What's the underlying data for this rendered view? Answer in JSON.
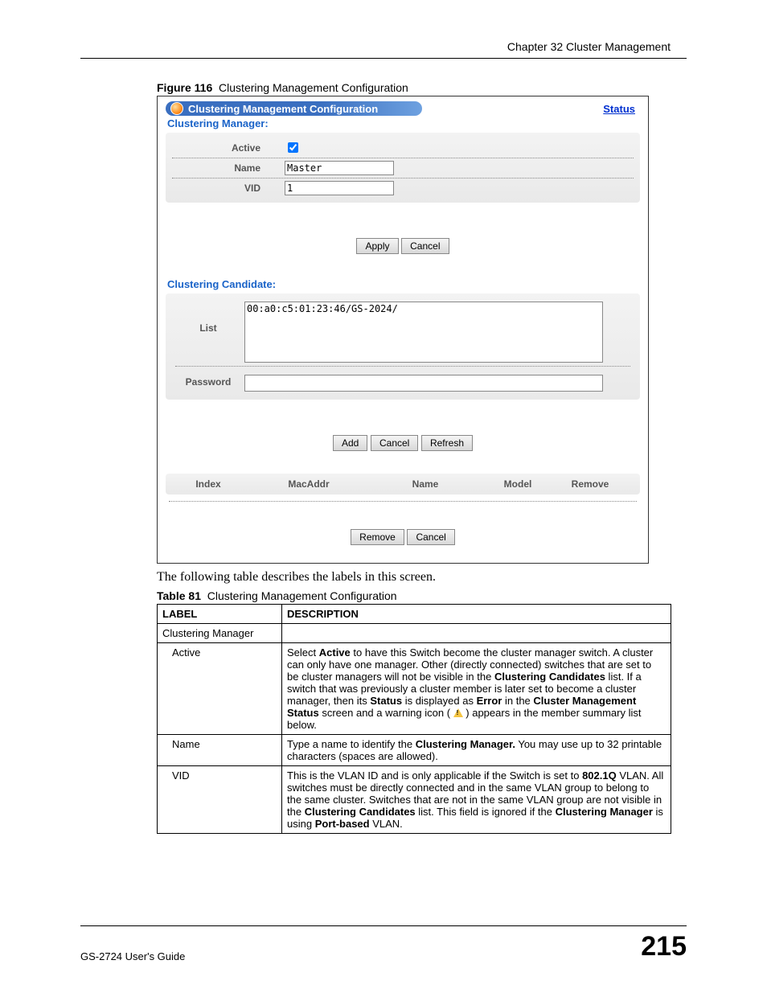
{
  "header": {
    "chapter": "Chapter 32 Cluster Management"
  },
  "figure": {
    "label": "Figure 116",
    "caption": "Clustering Management Configuration"
  },
  "ui": {
    "title": "Clustering Management Configuration",
    "status_link": "Status",
    "manager": {
      "heading": "Clustering Manager:",
      "rows": {
        "active_label": "Active",
        "active_checked": "true",
        "name_label": "Name",
        "name_value": "Master",
        "vid_label": "VID",
        "vid_value": "1"
      },
      "apply_btn": "Apply",
      "cancel_btn": "Cancel"
    },
    "candidate": {
      "heading": "Clustering Candidate:",
      "list_label": "List",
      "list_item": "00:a0:c5:01:23:46/GS-2024/",
      "password_label": "Password",
      "add_btn": "Add",
      "cancel_btn": "Cancel",
      "refresh_btn": "Refresh"
    },
    "members": {
      "cols": {
        "index": "Index",
        "mac": "MacAddr",
        "name": "Name",
        "model": "Model",
        "remove": "Remove"
      },
      "remove_btn": "Remove",
      "cancel_btn": "Cancel"
    }
  },
  "body_text": "The following table describes the labels in this screen.",
  "table": {
    "label": "Table 81",
    "caption": "Clustering Management Configuration",
    "head": {
      "c1": "LABEL",
      "c2": "DESCRIPTION"
    },
    "rows": [
      {
        "label": "Clustering Manager",
        "desc": ""
      },
      {
        "label": "Active",
        "desc_pre": "Select ",
        "b1": "Active",
        "t1": " to have this Switch become the cluster manager switch. A cluster can only have one manager. Other (directly connected) switches that are set to be cluster managers will not be visible in the ",
        "b2": "Clustering Candidates",
        "t2": " list. If a switch that was previously a cluster member is later set to become a cluster manager, then its ",
        "b3": "Status",
        "t3": " is displayed as ",
        "b4": "Error",
        "t4": " in the ",
        "b5": "Cluster Management Status",
        "t5": " screen and a warning icon ( ",
        "t6": " ) appears in the member summary list below."
      },
      {
        "label": "Name",
        "desc_pre": "Type a name to identify the ",
        "b1": "Clustering Manager.",
        "t1": " You may use up to 32 printable characters (spaces are allowed)."
      },
      {
        "label": "VID",
        "desc_pre": "This is the VLAN ID and is only applicable if the Switch is set to ",
        "b1": "802.1Q",
        "t1": " VLAN. All switches must be directly connected and in the same VLAN group to belong to the same cluster. Switches that are not in the same VLAN group are not visible in the ",
        "b2": "Clustering Candidates",
        "t2": " list. This field is ignored if the ",
        "b3": "Clustering Manager",
        "t3": " is using ",
        "b4": "Port-based",
        "t4": " VLAN."
      }
    ]
  },
  "footer": {
    "guide": "GS-2724 User's Guide",
    "page": "215"
  }
}
